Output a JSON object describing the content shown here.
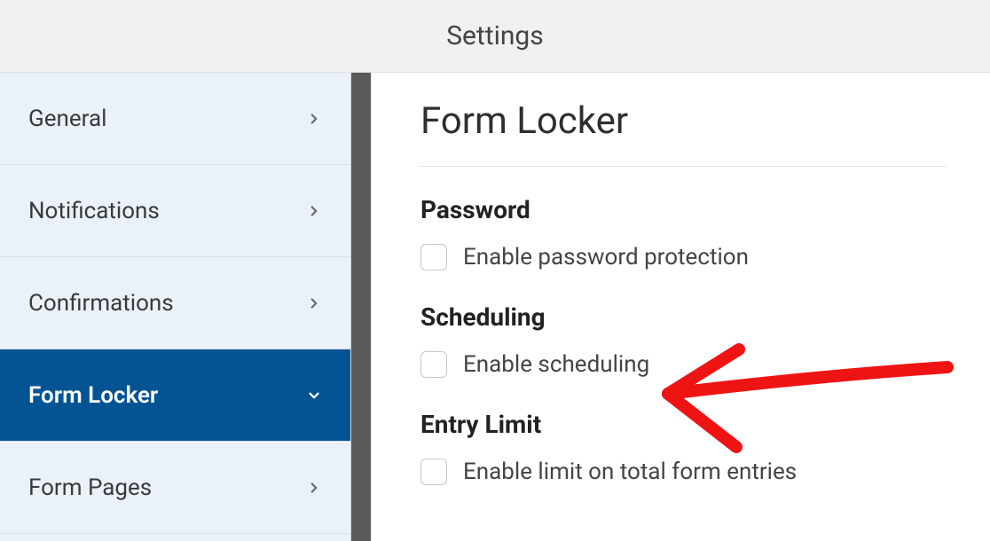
{
  "header": {
    "title": "Settings"
  },
  "sidebar": {
    "items": [
      {
        "label": "General",
        "active": false
      },
      {
        "label": "Notifications",
        "active": false
      },
      {
        "label": "Confirmations",
        "active": false
      },
      {
        "label": "Form Locker",
        "active": true
      },
      {
        "label": "Form Pages",
        "active": false
      }
    ]
  },
  "content": {
    "title": "Form Locker",
    "sections": [
      {
        "heading": "Password",
        "checkbox_label": "Enable password protection"
      },
      {
        "heading": "Scheduling",
        "checkbox_label": "Enable scheduling"
      },
      {
        "heading": "Entry Limit",
        "checkbox_label": "Enable limit on total form entries"
      }
    ]
  }
}
